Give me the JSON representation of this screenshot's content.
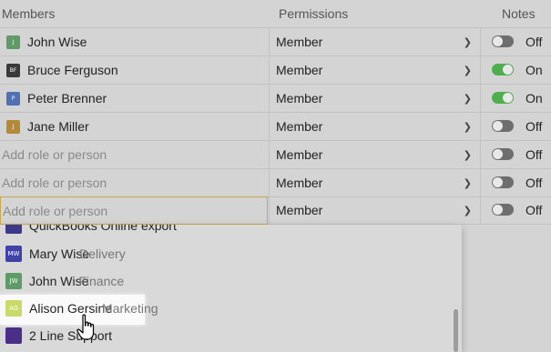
{
  "header": {
    "members": "Members",
    "permissions": "Permissions",
    "notes": "Notes"
  },
  "rows": [
    {
      "name": "John Wise",
      "avatar_initials": "J",
      "avatar_color": "#5f9b68",
      "permission": "Member",
      "notes_on": false,
      "notes_label": "Off"
    },
    {
      "name": "Bruce Ferguson",
      "avatar_initials": "BF",
      "avatar_color": "#3a3a3a",
      "permission": "Member",
      "notes_on": true,
      "notes_label": "On"
    },
    {
      "name": "Peter Brenner",
      "avatar_initials": "P",
      "avatar_color": "#5171b5",
      "permission": "Member",
      "notes_on": true,
      "notes_label": "On"
    },
    {
      "name": "Jane Miller",
      "avatar_initials": "J",
      "avatar_color": "#b48a39",
      "permission": "Member",
      "notes_on": false,
      "notes_label": "Off"
    },
    {
      "placeholder": "Add role or person",
      "permission": "Member",
      "notes_on": false,
      "notes_label": "Off"
    },
    {
      "placeholder": "Add role or person",
      "permission": "Member",
      "notes_on": false,
      "notes_label": "Off"
    },
    {
      "placeholder": "Add role or person",
      "permission": "Member",
      "notes_on": false,
      "notes_label": "Off",
      "focused": true
    }
  ],
  "dropdown": {
    "items": [
      {
        "name": "QuickBooks Online export",
        "dept": "",
        "avatar_color": "#3d3a8c",
        "avatar_initials": ""
      },
      {
        "name": "Mary Wise",
        "dept": "Delivery",
        "avatar_color": "#3f43a6",
        "avatar_initials": "MW"
      },
      {
        "name": "John Wise",
        "dept": "Finance",
        "avatar_color": "#5f9b68",
        "avatar_initials": "JW"
      },
      {
        "name": "Alison Gersine",
        "dept": "Marketing",
        "avatar_color": "#c9d96a",
        "avatar_initials": "AG"
      },
      {
        "name": "2 Line Support",
        "dept": "",
        "avatar_color": "#4a2f86",
        "avatar_initials": ""
      }
    ]
  },
  "colors": {
    "toggle_on": "#4fae4e",
    "toggle_off": "#6e6e6e",
    "focus_border": "#c9a94c"
  }
}
